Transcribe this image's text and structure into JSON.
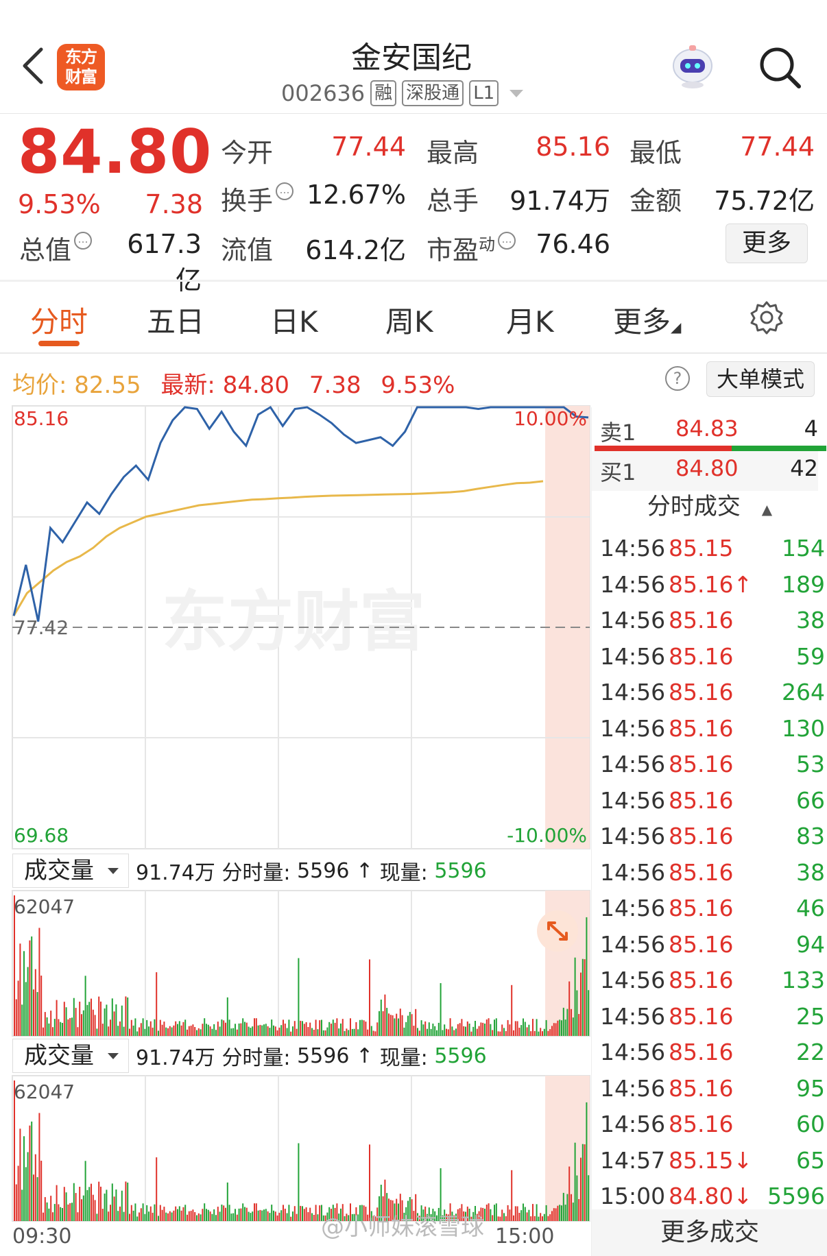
{
  "header": {
    "logo_text_1": "东方",
    "logo_text_2": "财富",
    "title": "金安国纪",
    "code": "002636",
    "tags": [
      "融",
      "深股通",
      "L1"
    ]
  },
  "quote": {
    "price": "84.80",
    "change_pct": "9.53%",
    "change_abs": "7.38",
    "fields": {
      "open_label": "今开",
      "open": "77.44",
      "high_label": "最高",
      "high": "85.16",
      "low_label": "最低",
      "low": "77.44",
      "turnover_label": "换手",
      "turnover": "12.67%",
      "volume_label": "总手",
      "volume": "91.74万",
      "amount_label": "金额",
      "amount": "75.72亿",
      "mktcap_label": "总值",
      "mktcap": "617.3亿",
      "float_label": "流值",
      "float": "614.2亿",
      "pe_label": "市盈",
      "pe_sup": "动",
      "pe": "76.46"
    },
    "more_label": "更多"
  },
  "tabs": [
    "分时",
    "五日",
    "日K",
    "周K",
    "月K",
    "更多"
  ],
  "strip": {
    "avg_label": "均价:",
    "avg": "82.55",
    "latest_label": "最新:",
    "latest": "84.80",
    "chg": "7.38",
    "pct": "9.53%",
    "mode_label": "大单模式"
  },
  "chart_data": {
    "type": "line",
    "top_left": "85.16",
    "top_right": "10.00%",
    "ref": "77.42",
    "bottom_left": "69.68",
    "bottom_right": "-10.00%",
    "ylim": [
      69.68,
      85.16
    ],
    "prev_close": 77.42,
    "watermark": "东方财富",
    "series": [
      {
        "values": [
          77.8,
          79.6,
          77.6,
          80.9,
          80.4,
          81.1,
          81.8,
          81.4,
          82.1,
          82.7,
          83.1,
          82.6,
          83.9,
          84.7,
          85.16,
          85.1,
          84.4,
          85.0,
          84.3,
          83.8,
          84.9,
          85.16,
          84.5,
          85.1,
          85.16,
          84.9,
          84.6,
          84.2,
          83.9,
          84.0,
          84.1,
          83.8,
          84.3,
          85.16,
          85.16,
          85.16,
          85.16,
          85.16,
          85.1,
          85.16,
          85.16,
          85.16,
          85.16,
          85.16,
          85.16,
          85.16,
          84.83,
          84.8
        ]
      },
      {
        "values": [
          77.8,
          78.6,
          79.0,
          79.4,
          79.7,
          79.9,
          80.2,
          80.6,
          80.9,
          81.1,
          81.3,
          81.4,
          81.5,
          81.6,
          81.7,
          81.75,
          81.8,
          81.85,
          81.9,
          81.92,
          81.95,
          81.97,
          82.0,
          82.02,
          82.04,
          82.05,
          82.06,
          82.07,
          82.08,
          82.09,
          82.1,
          82.12,
          82.14,
          82.16,
          82.2,
          82.28,
          82.35,
          82.42,
          82.48,
          82.5,
          82.55
        ]
      }
    ]
  },
  "volume": {
    "selector": "成交量",
    "total": "91.74万",
    "minute_label": "分时量:",
    "minute": "5596",
    "arrow": "↑",
    "now_label": "现量:",
    "now": "5596",
    "max": "62047",
    "time_start": "09:30",
    "time_end": "15:00"
  },
  "orderbook": {
    "ask_label": "卖1",
    "ask_price": "84.83",
    "ask_vol": "4",
    "bid_label": "买1",
    "bid_price": "84.80",
    "bid_vol": "42"
  },
  "trades_header": "分时成交",
  "trades": [
    {
      "t": "14:56",
      "p": "85.15",
      "v": "154",
      "vc": "green"
    },
    {
      "t": "14:56",
      "p": "85.16↑",
      "v": "189",
      "vc": "green"
    },
    {
      "t": "14:56",
      "p": "85.16",
      "v": "38",
      "vc": "green"
    },
    {
      "t": "14:56",
      "p": "85.16",
      "v": "59",
      "vc": "green"
    },
    {
      "t": "14:56",
      "p": "85.16",
      "v": "264",
      "vc": "green"
    },
    {
      "t": "14:56",
      "p": "85.16",
      "v": "130",
      "vc": "green"
    },
    {
      "t": "14:56",
      "p": "85.16",
      "v": "53",
      "vc": "green"
    },
    {
      "t": "14:56",
      "p": "85.16",
      "v": "66",
      "vc": "green"
    },
    {
      "t": "14:56",
      "p": "85.16",
      "v": "83",
      "vc": "green"
    },
    {
      "t": "14:56",
      "p": "85.16",
      "v": "38",
      "vc": "green"
    },
    {
      "t": "14:56",
      "p": "85.16",
      "v": "46",
      "vc": "green"
    },
    {
      "t": "14:56",
      "p": "85.16",
      "v": "94",
      "vc": "green"
    },
    {
      "t": "14:56",
      "p": "85.16",
      "v": "133",
      "vc": "green"
    },
    {
      "t": "14:56",
      "p": "85.16",
      "v": "25",
      "vc": "green"
    },
    {
      "t": "14:56",
      "p": "85.16",
      "v": "22",
      "vc": "green"
    },
    {
      "t": "14:56",
      "p": "85.16",
      "v": "95",
      "vc": "green"
    },
    {
      "t": "14:56",
      "p": "85.16",
      "v": "60",
      "vc": "green"
    },
    {
      "t": "14:57",
      "p": "85.15↓",
      "v": "65",
      "vc": "green"
    },
    {
      "t": "15:00",
      "p": "84.80↓",
      "v": "5596",
      "vc": "green"
    }
  ],
  "trades_more": "更多成交",
  "watermark": "@小师妹滚雪球",
  "colors": {
    "up": "#e0312a",
    "down": "#21a337",
    "avg": "#e8b84a",
    "price_line": "#2e62a8",
    "accent": "#e65a1f"
  }
}
